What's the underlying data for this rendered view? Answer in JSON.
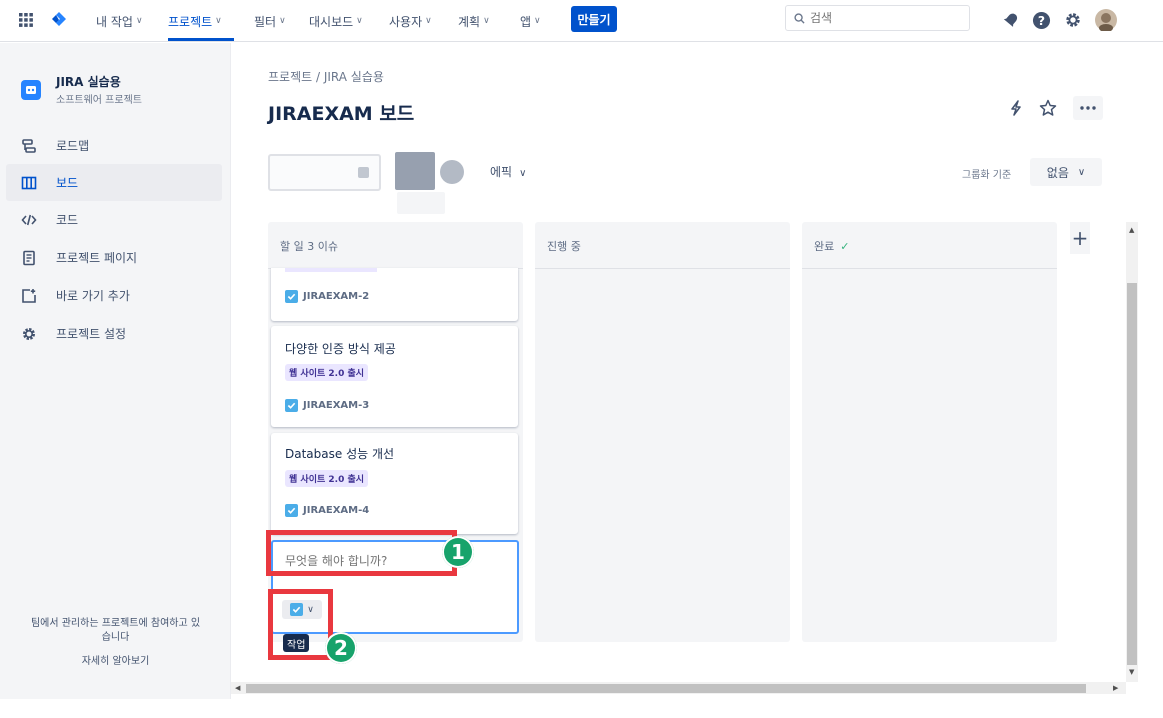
{
  "topnav": {
    "items": [
      {
        "label": "내 작업"
      },
      {
        "label": "프로젝트"
      },
      {
        "label": "필터"
      },
      {
        "label": "대시보드"
      },
      {
        "label": "사용자"
      },
      {
        "label": "계획"
      },
      {
        "label": "앱"
      }
    ],
    "create_label": "만들기",
    "search_placeholder": "검색",
    "icons": [
      "app-switcher-icon",
      "jira-logo-icon",
      "notification-icon",
      "help-icon",
      "settings-icon",
      "avatar"
    ]
  },
  "sidebar": {
    "project_name": "JIRA 실습용",
    "project_type": "소프트웨어 프로젝트",
    "items": [
      {
        "label": "로드맵",
        "icon": "roadmap-icon"
      },
      {
        "label": "보드",
        "icon": "board-icon",
        "selected": true
      },
      {
        "label": "코드",
        "icon": "code-icon"
      },
      {
        "label": "프로젝트 페이지",
        "icon": "page-icon"
      },
      {
        "label": "바로 가기 추가",
        "icon": "add-shortcut-icon"
      },
      {
        "label": "프로젝트 설정",
        "icon": "settings-icon"
      }
    ],
    "footer_line1": "팀에서 관리하는 프로젝트에 참여하고 있",
    "footer_line2": "습니다",
    "footer_link": "자세히 알아보기"
  },
  "main": {
    "breadcrumb": "프로젝트 / JIRA 실습용",
    "title": "JIRAEXAM 보드",
    "epic_filter": "에픽",
    "group_by_label": "그룹화 기준",
    "group_by_value": "없음"
  },
  "columns": [
    {
      "title": "할 일 3 이슈"
    },
    {
      "title": "진행 중"
    },
    {
      "title": "완료"
    }
  ],
  "cards": [
    {
      "title": "",
      "epic": "",
      "key": "JIRAEXAM-2"
    },
    {
      "title": "다양한 인증 방식 제공",
      "epic": "웹 사이트 2.0 출시",
      "key": "JIRAEXAM-3"
    },
    {
      "title": "Database 성능 개선",
      "epic": "웹 사이트 2.0 출시",
      "key": "JIRAEXAM-4"
    }
  ],
  "new_issue": {
    "placeholder": "무엇을 해야 합니까?",
    "type_tooltip": "작업"
  },
  "annotations": [
    {
      "label": "1"
    },
    {
      "label": "2"
    }
  ],
  "colors": {
    "accent": "#0052cc",
    "highlight": "#e9383f",
    "badge": "#17a36b",
    "epic_bg": "#eae6ff",
    "epic_text": "#403294"
  }
}
